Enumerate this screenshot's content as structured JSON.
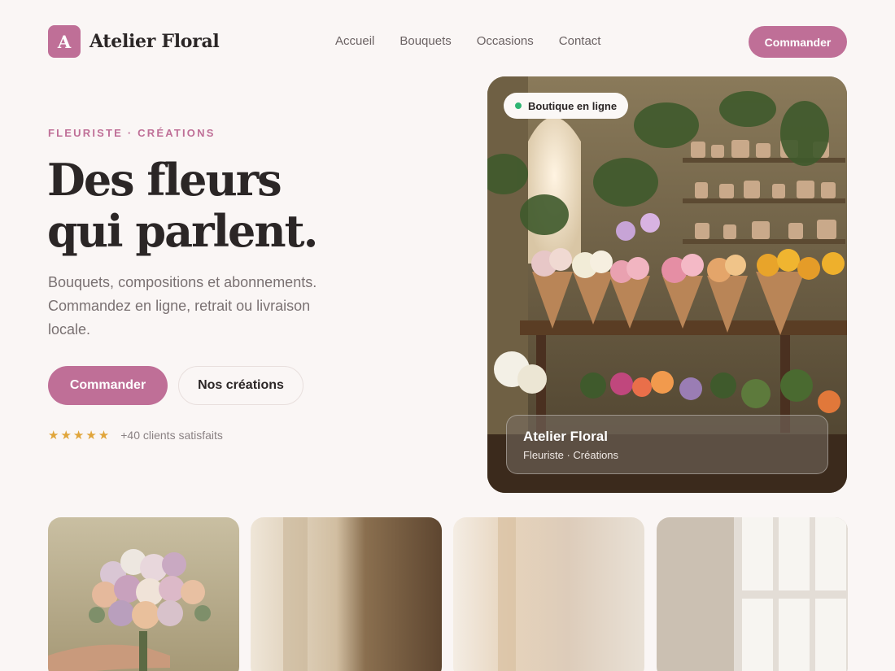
{
  "brand": {
    "initial": "A",
    "name": "Atelier Floral"
  },
  "nav": {
    "items": [
      "Accueil",
      "Bouquets",
      "Occasions",
      "Contact"
    ]
  },
  "header": {
    "cta_label": "Commander"
  },
  "hero": {
    "eyebrow": "FLEURISTE · CRÉATIONS",
    "title_line1": "Des fleurs",
    "title_line2": "qui parlent.",
    "description": "Bouquets, compositions et abonnements. Commandez en ligne, retrait ou livraison locale.",
    "primary_label": "Commander",
    "secondary_label": "Nos créations",
    "rating": {
      "stars": "★★★★★",
      "text": "+40 clients satisfaits"
    }
  },
  "hero_card": {
    "badge_label": "Boutique en ligne",
    "caption_title": "Atelier Floral",
    "caption_subtitle": "Fleuriste · Créations"
  },
  "colors": {
    "accent": "#bf6f97",
    "background": "#faf6f5",
    "status_online": "#2fb573",
    "stars": "#e0a53b"
  },
  "icons": {
    "status": "online-dot-icon",
    "rating": "star-icon"
  }
}
